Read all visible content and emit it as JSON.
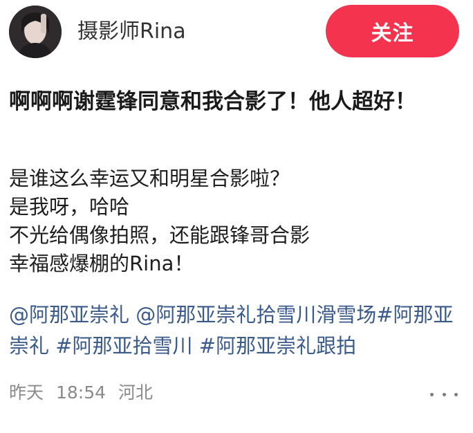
{
  "author": {
    "name": "摄影师Rina"
  },
  "follow_button": {
    "label": "关注"
  },
  "post": {
    "title": "啊啊啊谢霆锋同意和我合影了！他人超好！",
    "body_lines": [
      "是谁这么幸运又和明星合影啦？",
      "是我呀，哈哈",
      "不光给偶像拍照，还能跟锋哥合影",
      "幸福感爆棚的Rina！"
    ],
    "tags": [
      "@阿那亚崇礼",
      "@阿那亚崇礼拾雪川滑雪场",
      "#阿那亚崇礼",
      "#阿那亚拾雪川",
      "#阿那亚崇礼跟拍"
    ]
  },
  "meta": {
    "date": "昨天",
    "time": "18:54",
    "location": "河北"
  },
  "colors": {
    "follow_button": "#f4344f",
    "tag_link": "#3a5a8c",
    "meta_text": "#8a8a8a"
  },
  "icons": {
    "more": "more-dots-icon"
  }
}
